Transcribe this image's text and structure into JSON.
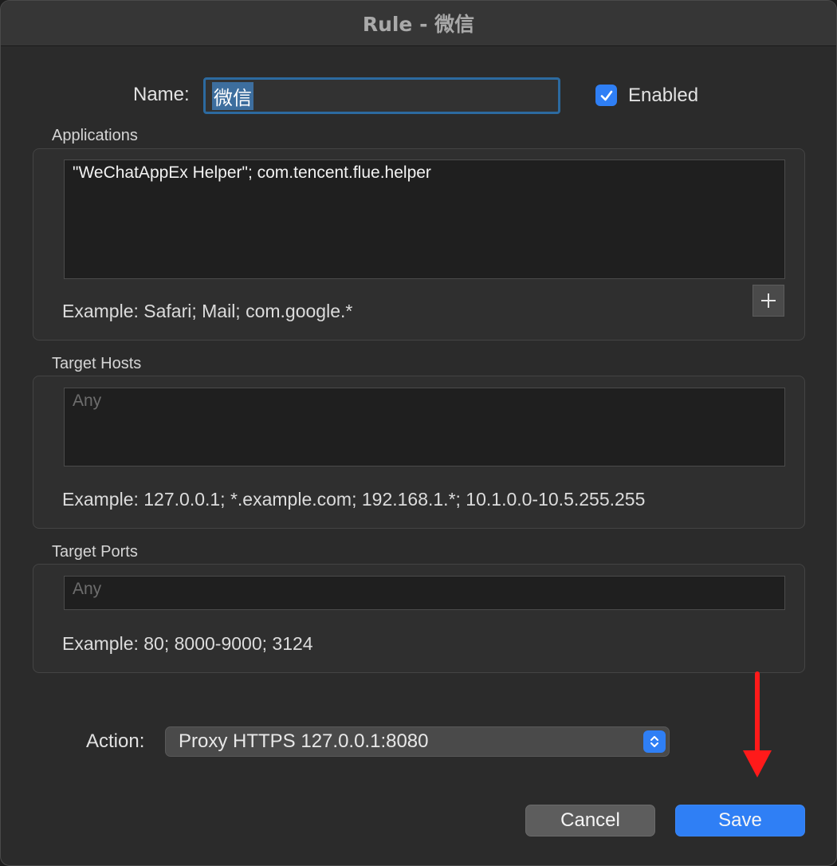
{
  "window": {
    "title": "Rule - 微信"
  },
  "name": {
    "label": "Name:",
    "value": "微信"
  },
  "enabled": {
    "label": "Enabled",
    "checked": true
  },
  "applications": {
    "label": "Applications",
    "value": "\"WeChatAppEx Helper\"; com.tencent.flue.helper",
    "example": "Example: Safari; Mail; com.google.*",
    "add_icon": "plus-icon"
  },
  "target_hosts": {
    "label": "Target Hosts",
    "placeholder": "Any",
    "example": "Example: 127.0.0.1; *.example.com; 192.168.1.*; 10.1.0.0-10.5.255.255"
  },
  "target_ports": {
    "label": "Target Ports",
    "placeholder": "Any",
    "example": "Example: 80; 8000-9000; 3124"
  },
  "action": {
    "label": "Action:",
    "selected": "Proxy HTTPS 127.0.0.1:8080"
  },
  "buttons": {
    "cancel": "Cancel",
    "save": "Save"
  },
  "colors": {
    "accent": "#2f7ff5",
    "annotation_arrow": "#ff0000"
  }
}
